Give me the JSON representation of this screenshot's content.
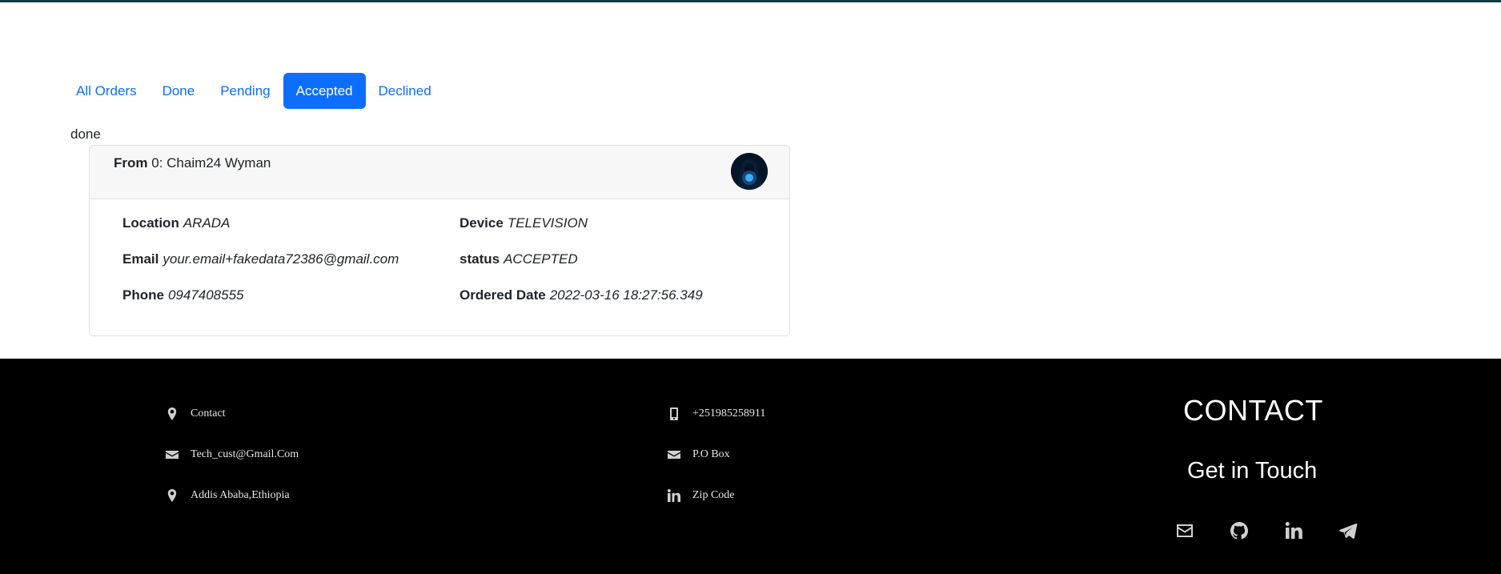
{
  "tabs": [
    {
      "label": "All Orders",
      "active": false
    },
    {
      "label": "Done",
      "active": false
    },
    {
      "label": "Pending",
      "active": false
    },
    {
      "label": "Accepted",
      "active": true
    },
    {
      "label": "Declined",
      "active": false
    }
  ],
  "section_label": "done",
  "order": {
    "from_key": "From",
    "from_index": "0",
    "from_name": "Chaim24 Wyman",
    "fields": {
      "location": {
        "key": "Location",
        "value": "ARADA"
      },
      "email": {
        "key": "Email",
        "value": "your.email+fakedata72386@gmail.com"
      },
      "phone": {
        "key": "Phone",
        "value": "0947408555"
      },
      "device": {
        "key": "Device",
        "value": "TELEVISION"
      },
      "status": {
        "key": "status",
        "value": "ACCEPTED"
      },
      "ordered_date": {
        "key": "Ordered Date",
        "value": "2022-03-16 18:27:56.349"
      }
    }
  },
  "footer": {
    "left": [
      {
        "icon": "map-marker-icon",
        "text": "Contact"
      },
      {
        "icon": "envelope-icon",
        "text": "Tech_cust@Gmail.Com"
      },
      {
        "icon": "map-marker-icon",
        "text": "Addis Ababa,Ethiopia"
      }
    ],
    "middle": [
      {
        "icon": "mobile-phone-icon",
        "text": "+251985258911"
      },
      {
        "icon": "envelope-icon",
        "text": "P.O Box"
      },
      {
        "icon": "linkedin-icon",
        "text": "Zip Code"
      }
    ],
    "contact_title": "CONTACT",
    "get_in_touch": "Get in Touch",
    "social": [
      "envelope-icon",
      "github-icon",
      "linkedin-icon",
      "telegram-icon"
    ]
  },
  "colors": {
    "primary": "#0d6efd",
    "footer_bg": "#000000",
    "top_line": "#0d3b47"
  }
}
